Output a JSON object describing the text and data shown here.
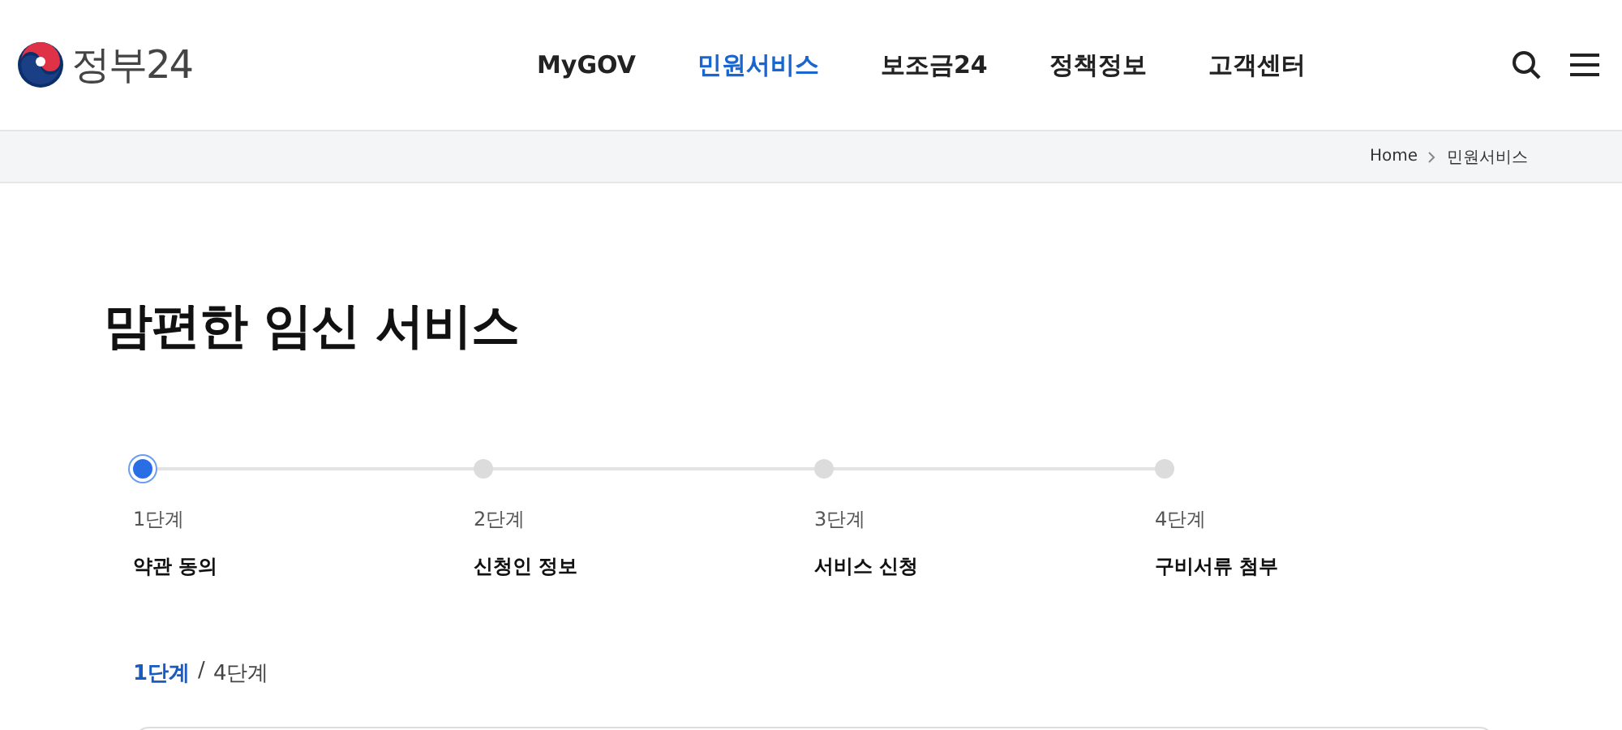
{
  "header": {
    "logo_text": "정부24",
    "nav": [
      {
        "label": "MyGOV",
        "selected": false
      },
      {
        "label": "민원서비스",
        "selected": true
      },
      {
        "label": "보조금24",
        "selected": false
      },
      {
        "label": "정책정보",
        "selected": false
      },
      {
        "label": "고객센터",
        "selected": false
      }
    ]
  },
  "breadcrumb": [
    "Home",
    "민원서비스"
  ],
  "page_title": "맘편한 임신 서비스",
  "steps": [
    {
      "step": "1단계",
      "label": "약관 동의",
      "selected": true
    },
    {
      "step": "2단계",
      "label": "신청인 정보",
      "selected": false
    },
    {
      "step": "3단계",
      "label": "서비스 신청",
      "selected": false
    },
    {
      "step": "4단계",
      "label": "구비서류 첨부",
      "selected": false
    }
  ],
  "step_counter": {
    "current": "1단계",
    "separator": "/",
    "total": "4단계"
  }
}
